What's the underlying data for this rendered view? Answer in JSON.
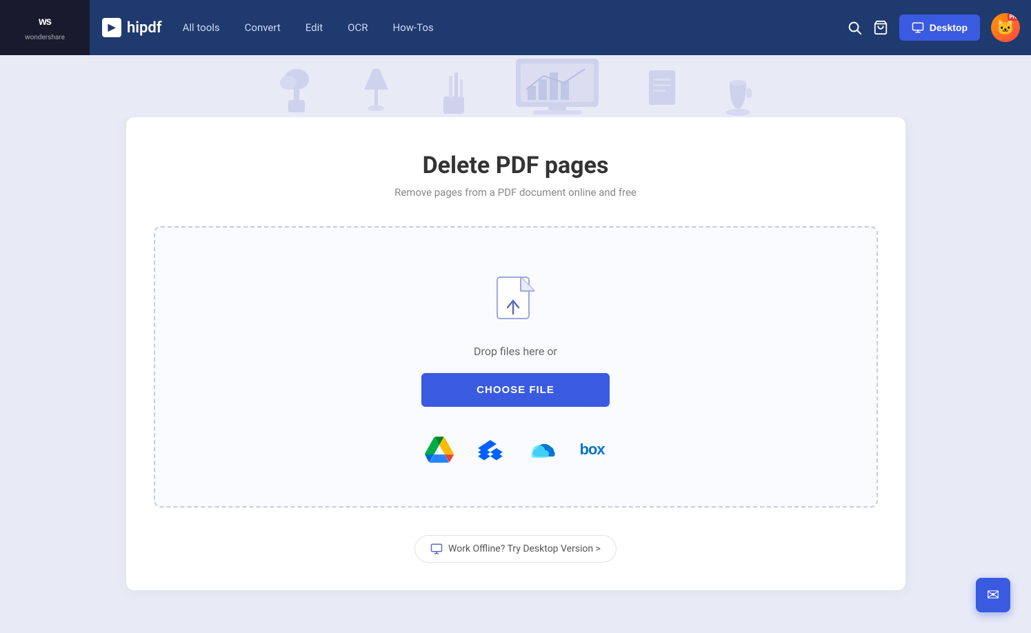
{
  "brand": {
    "wondershare": "wondershare",
    "hipdf": "hipdf"
  },
  "nav": {
    "links": [
      {
        "label": "All tools",
        "id": "all-tools"
      },
      {
        "label": "Convert",
        "id": "convert"
      },
      {
        "label": "Edit",
        "id": "edit"
      },
      {
        "label": "OCR",
        "id": "ocr"
      },
      {
        "label": "How-Tos",
        "id": "how-tos"
      }
    ],
    "desktop_btn": "Desktop",
    "pro_badge": "Pro"
  },
  "page": {
    "title": "Delete PDF pages",
    "subtitle": "Remove pages from a PDF document online and free"
  },
  "upload": {
    "drop_text": "Drop files here or",
    "choose_file_btn": "CHOOSE FILE",
    "cloud_services": [
      {
        "name": "Google Drive",
        "id": "gdrive"
      },
      {
        "name": "Dropbox",
        "id": "dropbox"
      },
      {
        "name": "OneDrive",
        "id": "onedrive"
      },
      {
        "name": "Box",
        "id": "box"
      }
    ]
  },
  "offline": {
    "label": "Work Offline? Try Desktop Version >"
  },
  "chat": {
    "icon": "✉"
  }
}
